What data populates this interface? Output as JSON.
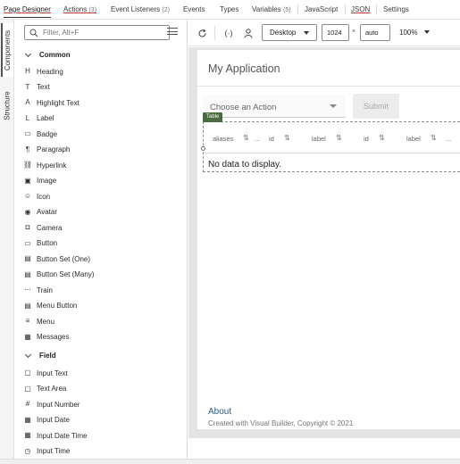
{
  "tabs": [
    {
      "label": "Page Designer",
      "count": ""
    },
    {
      "label": "Actions",
      "count": "(3)"
    },
    {
      "label": "Event Listeners",
      "count": "(2)"
    },
    {
      "label": "Events",
      "count": ""
    },
    {
      "label": "Types",
      "count": ""
    },
    {
      "label": "Variables",
      "count": "(5)"
    },
    {
      "label": "JavaScript",
      "count": ""
    },
    {
      "label": "JSON",
      "count": ""
    },
    {
      "label": "Settings",
      "count": ""
    }
  ],
  "side_tabs": {
    "components": "Components",
    "structure": "Structure"
  },
  "filter": {
    "placeholder": "Filter, Alt+F"
  },
  "groups": {
    "common": "Common",
    "field": "Field"
  },
  "components": [
    {
      "label": "Heading",
      "icon": "H"
    },
    {
      "label": "Text",
      "icon": "T"
    },
    {
      "label": "Highlight Text",
      "icon": "A"
    },
    {
      "label": "Label",
      "icon": "L"
    },
    {
      "label": "Badge",
      "icon": "badge"
    },
    {
      "label": "Paragraph",
      "icon": "¶"
    },
    {
      "label": "Hyperlink",
      "icon": "link"
    },
    {
      "label": "Image",
      "icon": "image"
    },
    {
      "label": "Icon",
      "icon": "icon"
    },
    {
      "label": "Avatar",
      "icon": "avatar"
    },
    {
      "label": "Camera",
      "icon": "camera"
    },
    {
      "label": "Button",
      "icon": "button"
    },
    {
      "label": "Button Set (One)",
      "icon": "buttonset"
    },
    {
      "label": "Button Set (Many)",
      "icon": "buttonset"
    },
    {
      "label": "Train",
      "icon": "train"
    },
    {
      "label": "Menu Button",
      "icon": "menubutton"
    },
    {
      "label": "Menu",
      "icon": "menu"
    },
    {
      "label": "Messages",
      "icon": "messages"
    }
  ],
  "field_components": [
    {
      "label": "Input Text",
      "icon": "inputtext"
    },
    {
      "label": "Text Area",
      "icon": "textarea"
    },
    {
      "label": "Input Number",
      "icon": "#"
    },
    {
      "label": "Input Date",
      "icon": "date"
    },
    {
      "label": "Input Date Time",
      "icon": "datetime"
    },
    {
      "label": "Input Time",
      "icon": "time"
    }
  ],
  "toolbar": {
    "device": "Desktop",
    "width": "1024",
    "height": "auto",
    "zoom": "100%",
    "times": "×"
  },
  "canvas": {
    "app_title": "My Application",
    "select_placeholder": "Choose an Action",
    "submit_label": "Submit",
    "table_badge": "Table",
    "columns": [
      "aliases",
      "...",
      "id",
      "label",
      "id",
      "label"
    ],
    "sort_glyph": "⇅",
    "no_data": "No data to display.",
    "about": "About",
    "copyright": "Created with Visual Builder, Copyright © 2021"
  }
}
